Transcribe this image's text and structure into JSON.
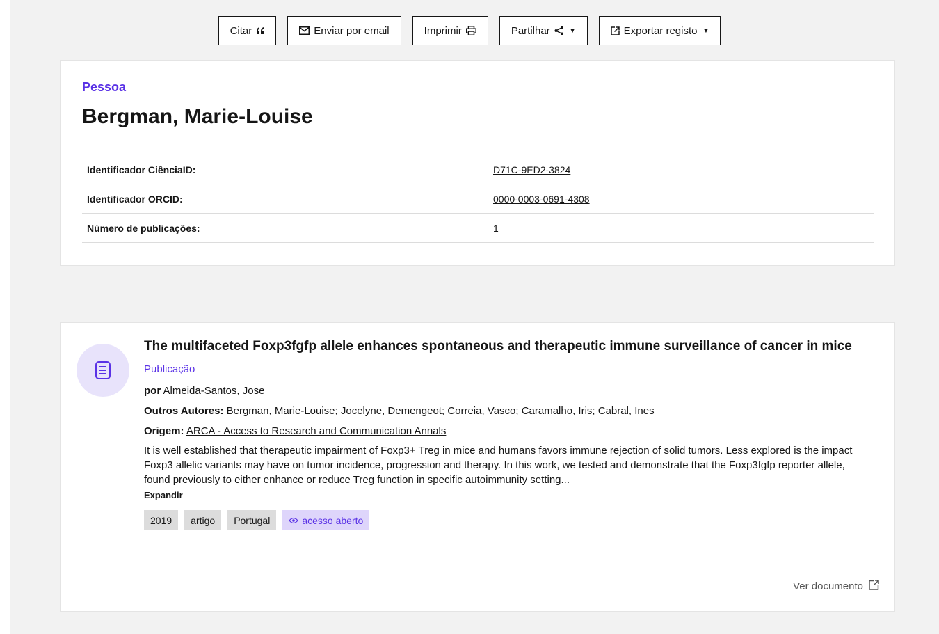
{
  "toolbar": {
    "cite_label": "Citar",
    "email_label": "Enviar por email",
    "print_label": "Imprimir",
    "share_label": "Partilhar",
    "export_label": "Exportar registo"
  },
  "person": {
    "eyebrow": "Pessoa",
    "name": "Bergman, Marie-Louise",
    "fields": [
      {
        "label": "Identificador CiênciaID:",
        "value": "D71C-9ED2-3824"
      },
      {
        "label": "Identificador ORCID:",
        "value": "0000-0003-0691-4308"
      },
      {
        "label": "Número de publicações:",
        "value": "1"
      }
    ]
  },
  "publication": {
    "icon": "document-icon",
    "title": "The multifaceted Foxp3fgfp allele enhances spontaneous and therapeutic immune surveillance of cancer in mice",
    "type": "Publicação",
    "by_label": "por",
    "author": "Almeida-Santos, Jose",
    "other_authors_label": "Outros Autores:",
    "other_authors": "Bergman, Marie-Louise; Jocelyne, Demengeot; Correia, Vasco; Caramalho, Iris; Cabral, Ines",
    "origin_label": "Origem:",
    "origin": "ARCA - Access to Research and Communication Annals",
    "abstract": "It is well established that therapeutic impairment of Foxp3+ Treg in mice and humans favors immune rejection of solid tumors. Less explored is the impact Foxp3 allelic variants may have on tumor incidence, progression and therapy. In this work, we tested and demonstrate that the Foxp3fgfp reporter allele, found previously to either enhance or reduce Treg function in specific autoimmunity setting...",
    "expand_label": "Expandir",
    "tags": {
      "year": "2019",
      "kind": "artigo",
      "country": "Portugal",
      "access": "acesso aberto"
    },
    "view_document_label": "Ver documento"
  },
  "colors": {
    "accent": "#5a32e6",
    "accent_light": "#ded5fb",
    "page_bg": "#f2f2f2"
  }
}
